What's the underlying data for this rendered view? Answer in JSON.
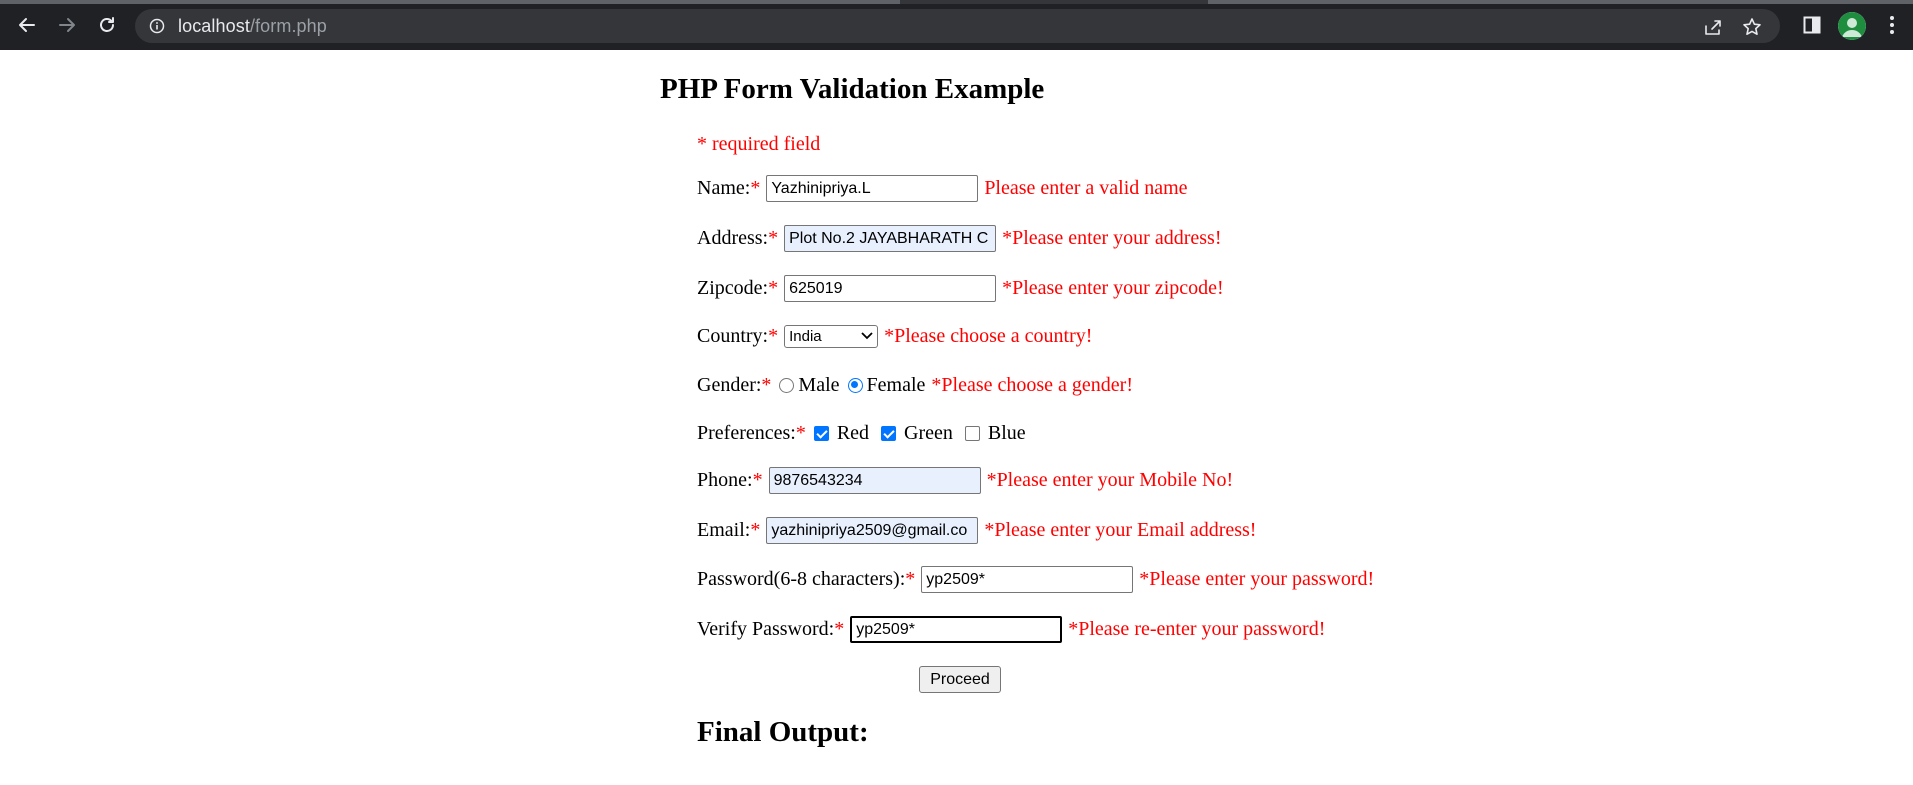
{
  "browser": {
    "url_host": "localhost",
    "url_path": "/form.php",
    "icons": [
      "back-icon",
      "forward-icon",
      "reload-icon",
      "info-icon",
      "share-icon",
      "bookmark-star-icon",
      "side-panel-icon",
      "profile-avatar",
      "menu-icon"
    ]
  },
  "page": {
    "title": "PHP Form Validation Example",
    "required_note": "* required field",
    "star": "*"
  },
  "form": {
    "name": {
      "label": "Name:",
      "value": "Yazhinipriya.L",
      "error": "Please enter a valid name"
    },
    "address": {
      "label": "Address:",
      "value": "Plot No.2 JAYABHARATH C",
      "error": "*Please enter your address!"
    },
    "zipcode": {
      "label": "Zipcode:",
      "value": "625019",
      "error": "*Please enter your zipcode!"
    },
    "country": {
      "label": "Country:",
      "selected": "India",
      "error": "*Please choose a country!"
    },
    "gender": {
      "label": "Gender:",
      "options": [
        {
          "label": "Male",
          "checked": false
        },
        {
          "label": "Female",
          "checked": true
        }
      ],
      "error": "*Please choose a gender!"
    },
    "preferences": {
      "label": "Preferences:",
      "options": [
        {
          "label": "Red",
          "checked": true
        },
        {
          "label": "Green",
          "checked": true
        },
        {
          "label": "Blue",
          "checked": false
        }
      ]
    },
    "phone": {
      "label": "Phone:",
      "value": "9876543234",
      "error": "*Please enter your Mobile No!"
    },
    "email": {
      "label": "Email:",
      "value": "yazhinipriya2509@gmail.co",
      "error": "*Please enter your Email address!"
    },
    "password": {
      "label": "Password(6-8 characters):",
      "value": "yp2509*",
      "error": "*Please enter your password!"
    },
    "verify_password": {
      "label": "Verify Password:",
      "value": "yp2509*",
      "error": "*Please re-enter your password!"
    },
    "submit_label": "Proceed"
  },
  "output": {
    "heading": "Final Output:"
  },
  "colors": {
    "error": "#ff0000",
    "autofill_bg": "#e8f0fe",
    "accent": "#0075ff",
    "chrome_bg": "#202124"
  }
}
